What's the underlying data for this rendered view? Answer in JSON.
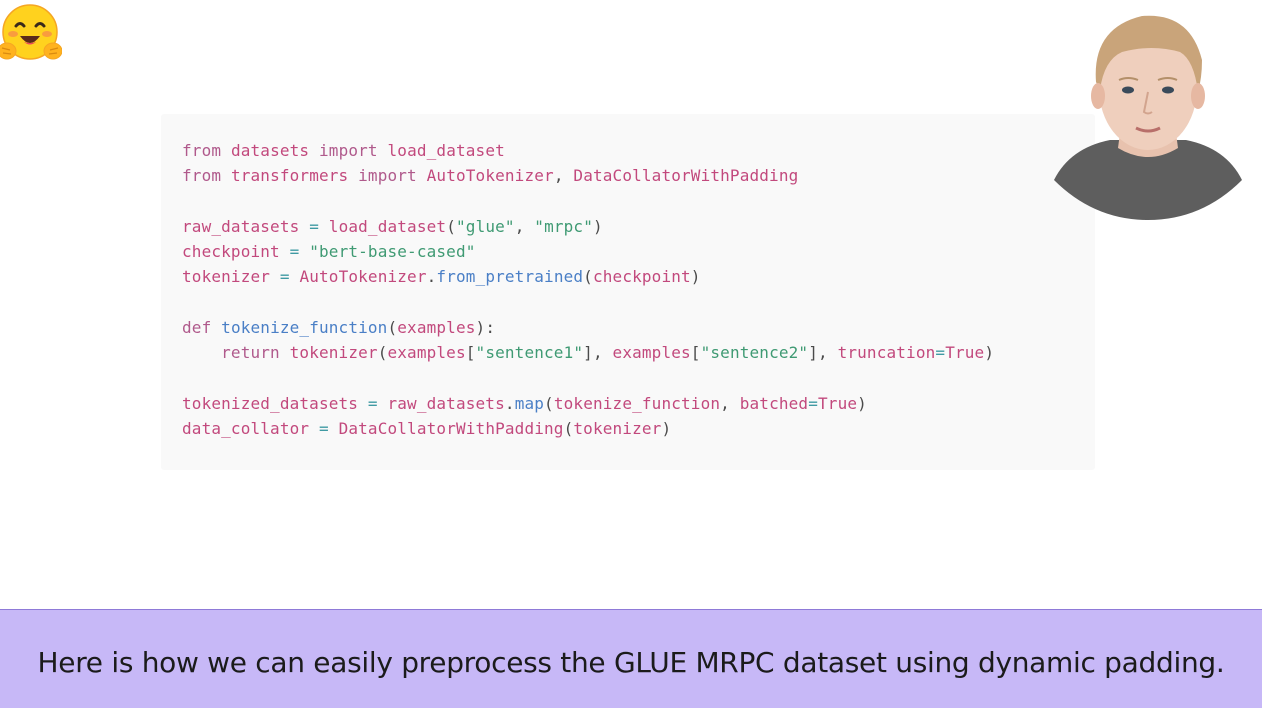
{
  "logo": {
    "icon": "hugging-face-emoji-icon"
  },
  "code": {
    "lines": [
      [
        {
          "t": "from",
          "c": "kw"
        },
        {
          "t": " ",
          "c": "plain"
        },
        {
          "t": "datasets",
          "c": "var"
        },
        {
          "t": " ",
          "c": "plain"
        },
        {
          "t": "import",
          "c": "kw"
        },
        {
          "t": " ",
          "c": "plain"
        },
        {
          "t": "load_dataset",
          "c": "var"
        }
      ],
      [
        {
          "t": "from",
          "c": "kw"
        },
        {
          "t": " ",
          "c": "plain"
        },
        {
          "t": "transformers",
          "c": "var"
        },
        {
          "t": " ",
          "c": "plain"
        },
        {
          "t": "import",
          "c": "kw"
        },
        {
          "t": " ",
          "c": "plain"
        },
        {
          "t": "AutoTokenizer",
          "c": "var"
        },
        {
          "t": ", ",
          "c": "plain"
        },
        {
          "t": "DataCollatorWithPadding",
          "c": "var"
        }
      ],
      [],
      [
        {
          "t": "raw_datasets",
          "c": "var"
        },
        {
          "t": " ",
          "c": "plain"
        },
        {
          "t": "=",
          "c": "op"
        },
        {
          "t": " ",
          "c": "plain"
        },
        {
          "t": "load_dataset",
          "c": "var"
        },
        {
          "t": "(",
          "c": "plain"
        },
        {
          "t": "\"glue\"",
          "c": "str"
        },
        {
          "t": ", ",
          "c": "plain"
        },
        {
          "t": "\"mrpc\"",
          "c": "str"
        },
        {
          "t": ")",
          "c": "plain"
        }
      ],
      [
        {
          "t": "checkpoint",
          "c": "var"
        },
        {
          "t": " ",
          "c": "plain"
        },
        {
          "t": "=",
          "c": "op"
        },
        {
          "t": " ",
          "c": "plain"
        },
        {
          "t": "\"bert-base-cased\"",
          "c": "str"
        }
      ],
      [
        {
          "t": "tokenizer",
          "c": "var"
        },
        {
          "t": " ",
          "c": "plain"
        },
        {
          "t": "=",
          "c": "op"
        },
        {
          "t": " ",
          "c": "plain"
        },
        {
          "t": "AutoTokenizer",
          "c": "var"
        },
        {
          "t": ".",
          "c": "plain"
        },
        {
          "t": "from_pretrained",
          "c": "fn"
        },
        {
          "t": "(",
          "c": "plain"
        },
        {
          "t": "checkpoint",
          "c": "var"
        },
        {
          "t": ")",
          "c": "plain"
        }
      ],
      [],
      [
        {
          "t": "def",
          "c": "kw"
        },
        {
          "t": " ",
          "c": "plain"
        },
        {
          "t": "tokenize_function",
          "c": "fn"
        },
        {
          "t": "(",
          "c": "plain"
        },
        {
          "t": "examples",
          "c": "var"
        },
        {
          "t": "):",
          "c": "plain"
        }
      ],
      [
        {
          "t": "    ",
          "c": "plain"
        },
        {
          "t": "return",
          "c": "kw"
        },
        {
          "t": " ",
          "c": "plain"
        },
        {
          "t": "tokenizer",
          "c": "var"
        },
        {
          "t": "(",
          "c": "plain"
        },
        {
          "t": "examples",
          "c": "var"
        },
        {
          "t": "[",
          "c": "plain"
        },
        {
          "t": "\"sentence1\"",
          "c": "str"
        },
        {
          "t": "], ",
          "c": "plain"
        },
        {
          "t": "examples",
          "c": "var"
        },
        {
          "t": "[",
          "c": "plain"
        },
        {
          "t": "\"sentence2\"",
          "c": "str"
        },
        {
          "t": "], ",
          "c": "plain"
        },
        {
          "t": "truncation",
          "c": "var"
        },
        {
          "t": "=",
          "c": "op"
        },
        {
          "t": "True",
          "c": "var"
        },
        {
          "t": ")",
          "c": "plain"
        }
      ],
      [],
      [
        {
          "t": "tokenized_datasets",
          "c": "var"
        },
        {
          "t": " ",
          "c": "plain"
        },
        {
          "t": "=",
          "c": "op"
        },
        {
          "t": " ",
          "c": "plain"
        },
        {
          "t": "raw_datasets",
          "c": "var"
        },
        {
          "t": ".",
          "c": "plain"
        },
        {
          "t": "map",
          "c": "fn"
        },
        {
          "t": "(",
          "c": "plain"
        },
        {
          "t": "tokenize_function",
          "c": "var"
        },
        {
          "t": ", ",
          "c": "plain"
        },
        {
          "t": "batched",
          "c": "var"
        },
        {
          "t": "=",
          "c": "op"
        },
        {
          "t": "True",
          "c": "var"
        },
        {
          "t": ")",
          "c": "plain"
        }
      ],
      [
        {
          "t": "data_collator",
          "c": "var"
        },
        {
          "t": " ",
          "c": "plain"
        },
        {
          "t": "=",
          "c": "op"
        },
        {
          "t": " ",
          "c": "plain"
        },
        {
          "t": "DataCollatorWithPadding",
          "c": "var"
        },
        {
          "t": "(",
          "c": "plain"
        },
        {
          "t": "tokenizer",
          "c": "var"
        },
        {
          "t": ")",
          "c": "plain"
        }
      ]
    ]
  },
  "webcam": {
    "icon": "presenter-webcam-icon"
  },
  "subtitle": {
    "text": "Here is how we can easily preprocess the GLUE MRPC dataset using dynamic padding."
  },
  "colors": {
    "subtitle_bg": "#c7b8f7",
    "code_bg": "#f9f9f9",
    "keyword": "#b05a8c",
    "identifier": "#c2497d",
    "function": "#4a7fc6",
    "string": "#3f9a73",
    "operator": "#3f9aa3"
  }
}
